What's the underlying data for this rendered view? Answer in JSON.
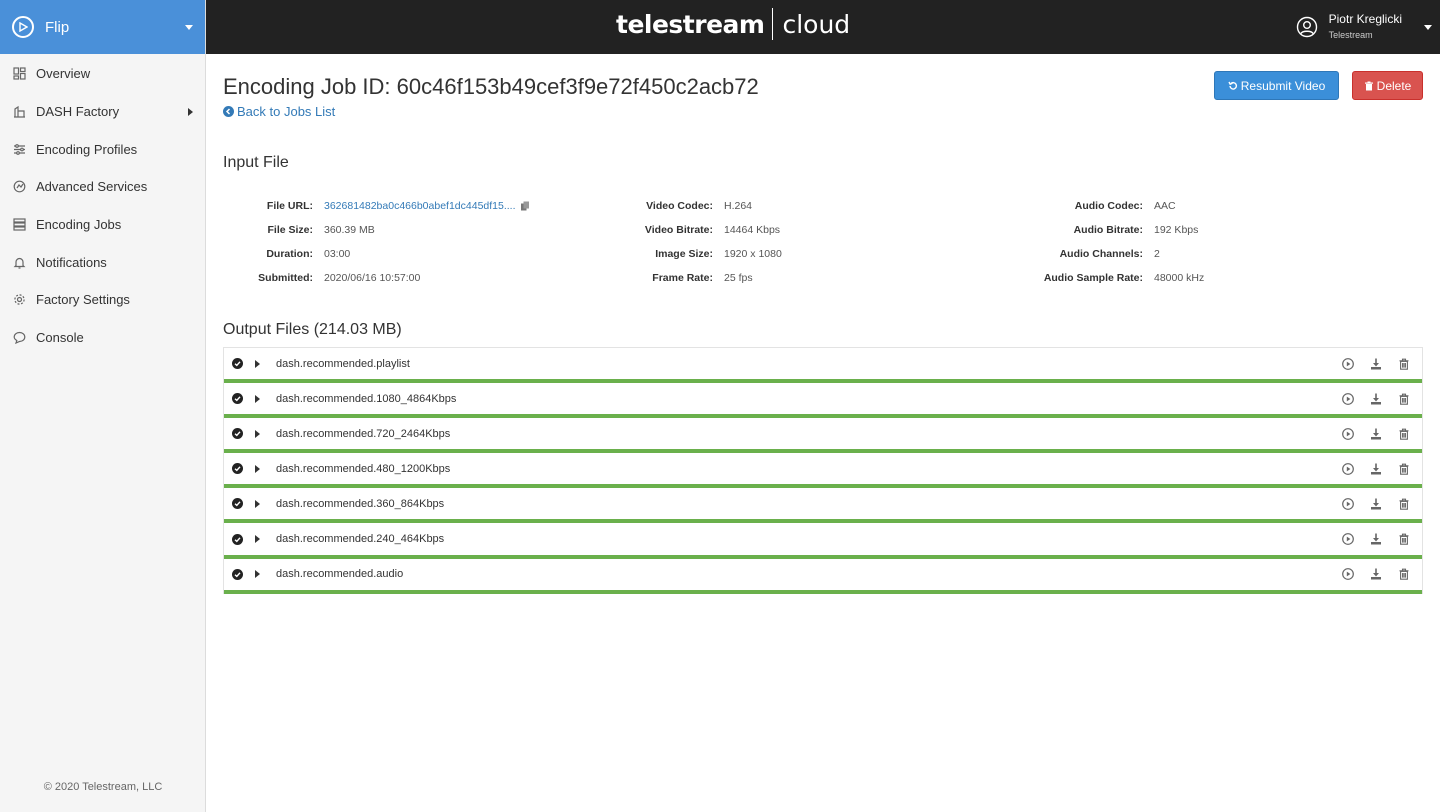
{
  "brand": {
    "name": "Flip"
  },
  "sidebar": {
    "items": [
      {
        "label": "Overview",
        "icon": "grid-icon"
      },
      {
        "label": "DASH Factory",
        "icon": "factory-icon"
      },
      {
        "label": "Encoding Profiles",
        "icon": "sliders-icon"
      },
      {
        "label": "Advanced Services",
        "icon": "services-icon"
      },
      {
        "label": "Encoding Jobs",
        "icon": "server-icon"
      },
      {
        "label": "Notifications",
        "icon": "bell-icon"
      },
      {
        "label": "Factory Settings",
        "icon": "gear-icon"
      },
      {
        "label": "Console",
        "icon": "chat-icon"
      }
    ],
    "copyright": "© 2020 Telestream, LLC"
  },
  "topbar": {
    "logo_part1": "telestream",
    "logo_part2": "cloud",
    "user_name": "Piotr Kreglicki",
    "user_org": "Telestream"
  },
  "header": {
    "title": "Encoding Job ID: 60c46f153b49cef3f9e72f450c2acb72",
    "back_label": "Back to Jobs List",
    "resubmit_label": "Resubmit Video",
    "delete_label": "Delete"
  },
  "input_file": {
    "title": "Input File",
    "col1": [
      {
        "key": "File URL:",
        "value": "362681482ba0c466b0abef1dc445df15...."
      },
      {
        "key": "File Size:",
        "value": "360.39 MB"
      },
      {
        "key": "Duration:",
        "value": "03:00"
      },
      {
        "key": "Submitted:",
        "value": "2020/06/16 10:57:00"
      }
    ],
    "col2": [
      {
        "key": "Video Codec:",
        "value": "H.264"
      },
      {
        "key": "Video Bitrate:",
        "value": "14464 Kbps"
      },
      {
        "key": "Image Size:",
        "value": "1920 x 1080"
      },
      {
        "key": "Frame Rate:",
        "value": "25 fps"
      }
    ],
    "col3": [
      {
        "key": "Audio Codec:",
        "value": "AAC"
      },
      {
        "key": "Audio Bitrate:",
        "value": "192 Kbps"
      },
      {
        "key": "Audio Channels:",
        "value": "2"
      },
      {
        "key": "Audio Sample Rate:",
        "value": "48000 kHz"
      }
    ]
  },
  "output_files": {
    "title": "Output Files (214.03 MB)",
    "items": [
      "dash.recommended.playlist",
      "dash.recommended.1080_4864Kbps",
      "dash.recommended.720_2464Kbps",
      "dash.recommended.480_1200Kbps",
      "dash.recommended.360_864Kbps",
      "dash.recommended.240_464Kbps",
      "dash.recommended.audio"
    ],
    "progress_percent": 100,
    "progress_color": "#6ab04c"
  },
  "colors": {
    "brand": "#4a90d9",
    "topbar": "#222222",
    "link": "#337ab7",
    "resubmit": "#3b8fd9",
    "delete": "#d9534f"
  }
}
